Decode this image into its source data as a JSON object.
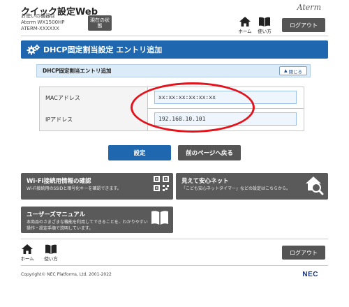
{
  "header": {
    "app_title": "クイック設定Web",
    "device_caption": "お使いの機器は",
    "device_model": "Aterm WX1500HP",
    "device_name": "ATERM-XXXXXX",
    "status_button": "現在の状態",
    "brand": "Aterm",
    "home_label": "ホーム",
    "manual_label": "使い方",
    "logout_label": "ログアウト"
  },
  "page": {
    "title": "DHCP固定割当設定 エントリ追加"
  },
  "entry": {
    "section_title": "DHCP固定割当エントリ追加",
    "close_label": "閉じる",
    "mac_label": "MACアドレス",
    "mac_value": "xx:xx:xx:xx:xx:xx",
    "ip_label": "IPアドレス",
    "ip_value": "192.168.10.101"
  },
  "actions": {
    "submit_label": "設定",
    "back_label": "前のページへ戻る"
  },
  "tiles": {
    "wifi_title": "Wi-Fi接続用情報の確認",
    "wifi_desc": "Wi-Fi接続用のSSIDと暗号化キーを確認できます。",
    "safety_title": "見えて安心ネット",
    "safety_desc": "「こども安心ネットタイマー」などの設定はこちらから。",
    "manual_title": "ユーザーズマニュアル",
    "manual_desc": "本商品のさまざまな機能を利用してできることを、わかりやすい操作・設定手順で説明しています。"
  },
  "footer": {
    "home_label": "ホーム",
    "manual_label": "使い方",
    "logout_label": "ログアウト",
    "copyright": "Copyright© NEC Platforms, Ltd. 2001-2022",
    "logo": "NEC"
  },
  "colors": {
    "primary": "#1f67ae",
    "dark_button": "#555555",
    "highlight": "#e3131b",
    "input_bg": "#eef5fd"
  }
}
